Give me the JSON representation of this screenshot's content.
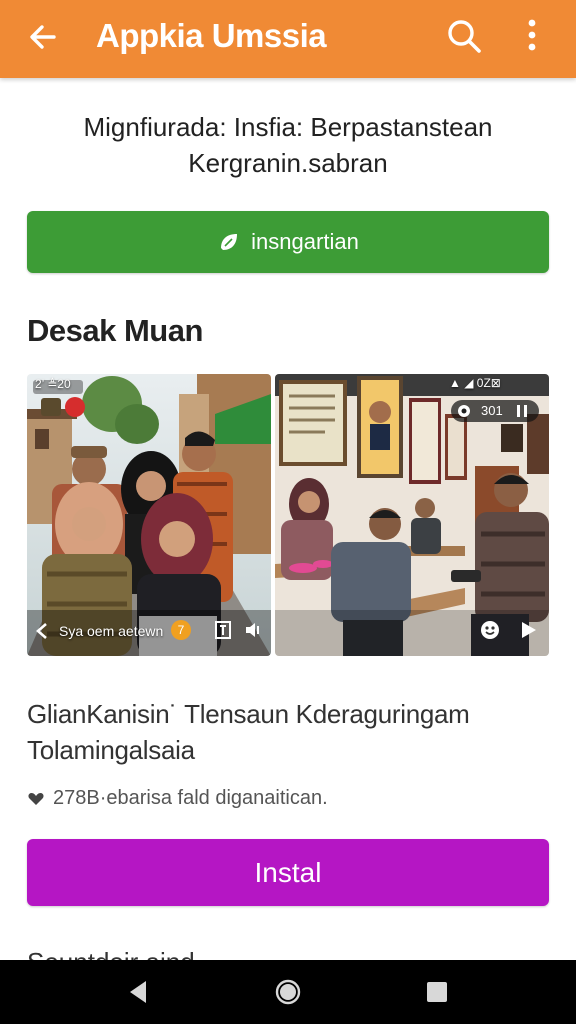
{
  "app_bar": {
    "title": "Appkia Umssia",
    "back_icon": "arrow-left-icon",
    "search_icon": "search-icon",
    "menu_icon": "more-vert-icon",
    "color": "#f08a35"
  },
  "header": {
    "line1": "Mignfiurada: Insfia: Berpastanstean",
    "line2": "Kergranin.sabran"
  },
  "green_button": {
    "label": "insngartian",
    "icon": "leaf-icon",
    "color": "#3d9c36"
  },
  "section": {
    "title": "Desak Muan"
  },
  "gallery": {
    "left": {
      "status_time": "2’ ≜20",
      "caption": "Sya oem aetewn",
      "badge": "7"
    },
    "right": {
      "status": "▲ ◢ 0Z⊠",
      "view_count": "301",
      "pause_icon": "pause-icon"
    }
  },
  "description": {
    "line1": "GlianKanisin˙ Tlensaun Kderaguringam",
    "line2": "Tolamingalsaia"
  },
  "meta": {
    "icon": "heart-icon",
    "text": "278B·ebarisa fald diganaitican."
  },
  "install_button": {
    "label": "Instal",
    "color": "#b516c4"
  },
  "partial_text": "Seuntdeir aind",
  "navbar": {
    "back": "nav-back-icon",
    "home": "nav-home-icon",
    "recents": "nav-recents-icon"
  }
}
